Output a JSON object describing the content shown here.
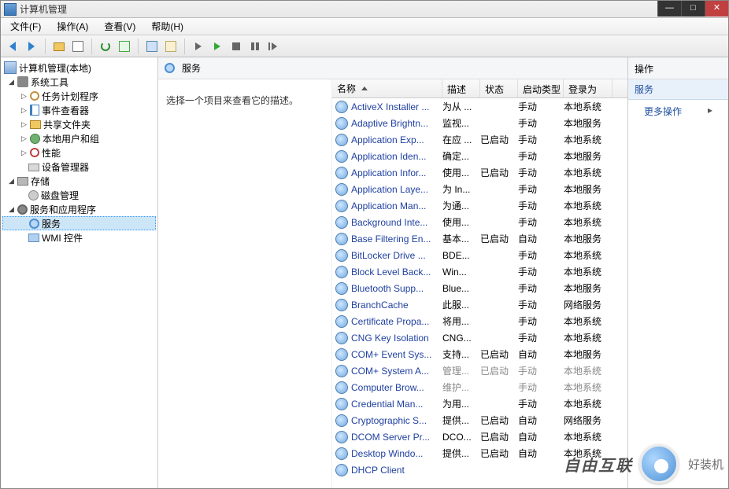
{
  "window": {
    "title": "计算机管理"
  },
  "menu": {
    "file": "文件(F)",
    "action": "操作(A)",
    "view": "查看(V)",
    "help": "帮助(H)"
  },
  "tree": {
    "root": "计算机管理(本地)",
    "sys_tools": "系统工具",
    "task_sched": "任务计划程序",
    "event_viewer": "事件查看器",
    "shared_folders": "共享文件夹",
    "local_users": "本地用户和组",
    "performance": "性能",
    "device_mgr": "设备管理器",
    "storage": "存储",
    "disk_mgmt": "磁盘管理",
    "services_apps": "服务和应用程序",
    "services": "服务",
    "wmi_ctrl": "WMI 控件"
  },
  "center": {
    "header_title": "服务",
    "hint": "选择一个项目来查看它的描述。"
  },
  "columns": {
    "name": "名称",
    "desc": "描述",
    "status": "状态",
    "startup": "启动类型",
    "logon": "登录为"
  },
  "services": [
    {
      "name": "ActiveX Installer ...",
      "desc": "为从 ...",
      "status": "",
      "startup": "手动",
      "logon": "本地系统"
    },
    {
      "name": "Adaptive Brightn...",
      "desc": "监视...",
      "status": "",
      "startup": "手动",
      "logon": "本地服务"
    },
    {
      "name": "Application Exp...",
      "desc": "在应 ...",
      "status": "已启动",
      "startup": "手动",
      "logon": "本地系统"
    },
    {
      "name": "Application Iden...",
      "desc": "确定...",
      "status": "",
      "startup": "手动",
      "logon": "本地服务"
    },
    {
      "name": "Application Infor...",
      "desc": "使用...",
      "status": "已启动",
      "startup": "手动",
      "logon": "本地系统"
    },
    {
      "name": "Application Laye...",
      "desc": "为 In...",
      "status": "",
      "startup": "手动",
      "logon": "本地服务"
    },
    {
      "name": "Application Man...",
      "desc": "为通...",
      "status": "",
      "startup": "手动",
      "logon": "本地系统"
    },
    {
      "name": "Background Inte...",
      "desc": "使用...",
      "status": "",
      "startup": "手动",
      "logon": "本地系统"
    },
    {
      "name": "Base Filtering En...",
      "desc": "基本...",
      "status": "已启动",
      "startup": "自动",
      "logon": "本地服务"
    },
    {
      "name": "BitLocker Drive ...",
      "desc": "BDE...",
      "status": "",
      "startup": "手动",
      "logon": "本地系统"
    },
    {
      "name": "Block Level Back...",
      "desc": "Win...",
      "status": "",
      "startup": "手动",
      "logon": "本地系统"
    },
    {
      "name": "Bluetooth Supp...",
      "desc": "Blue...",
      "status": "",
      "startup": "手动",
      "logon": "本地服务"
    },
    {
      "name": "BranchCache",
      "desc": "此服...",
      "status": "",
      "startup": "手动",
      "logon": "网络服务"
    },
    {
      "name": "Certificate Propa...",
      "desc": "将用...",
      "status": "",
      "startup": "手动",
      "logon": "本地系统"
    },
    {
      "name": "CNG Key Isolation",
      "desc": "CNG...",
      "status": "",
      "startup": "手动",
      "logon": "本地系统"
    },
    {
      "name": "COM+ Event Sys...",
      "desc": "支持...",
      "status": "已启动",
      "startup": "自动",
      "logon": "本地服务"
    },
    {
      "name": "COM+ System A...",
      "desc": "管理...",
      "status": "已启动",
      "startup": "手动",
      "logon": "本地系统",
      "gray": true
    },
    {
      "name": "Computer Brow...",
      "desc": "维护...",
      "status": "",
      "startup": "手动",
      "logon": "本地系统",
      "gray": true
    },
    {
      "name": "Credential Man...",
      "desc": "为用...",
      "status": "",
      "startup": "手动",
      "logon": "本地系统"
    },
    {
      "name": "Cryptographic S...",
      "desc": "提供...",
      "status": "已启动",
      "startup": "自动",
      "logon": "网络服务"
    },
    {
      "name": "DCOM Server Pr...",
      "desc": "DCO...",
      "status": "已启动",
      "startup": "自动",
      "logon": "本地系统"
    },
    {
      "name": "Desktop Windo...",
      "desc": "提供...",
      "status": "已启动",
      "startup": "自动",
      "logon": "本地系统"
    },
    {
      "name": "DHCP Client",
      "desc": "",
      "status": "",
      "startup": "",
      "logon": ""
    }
  ],
  "actions": {
    "header": "操作",
    "band": "服务",
    "more": "更多操作"
  },
  "watermark": {
    "line1": "自由互联",
    "brand": "好装机"
  }
}
